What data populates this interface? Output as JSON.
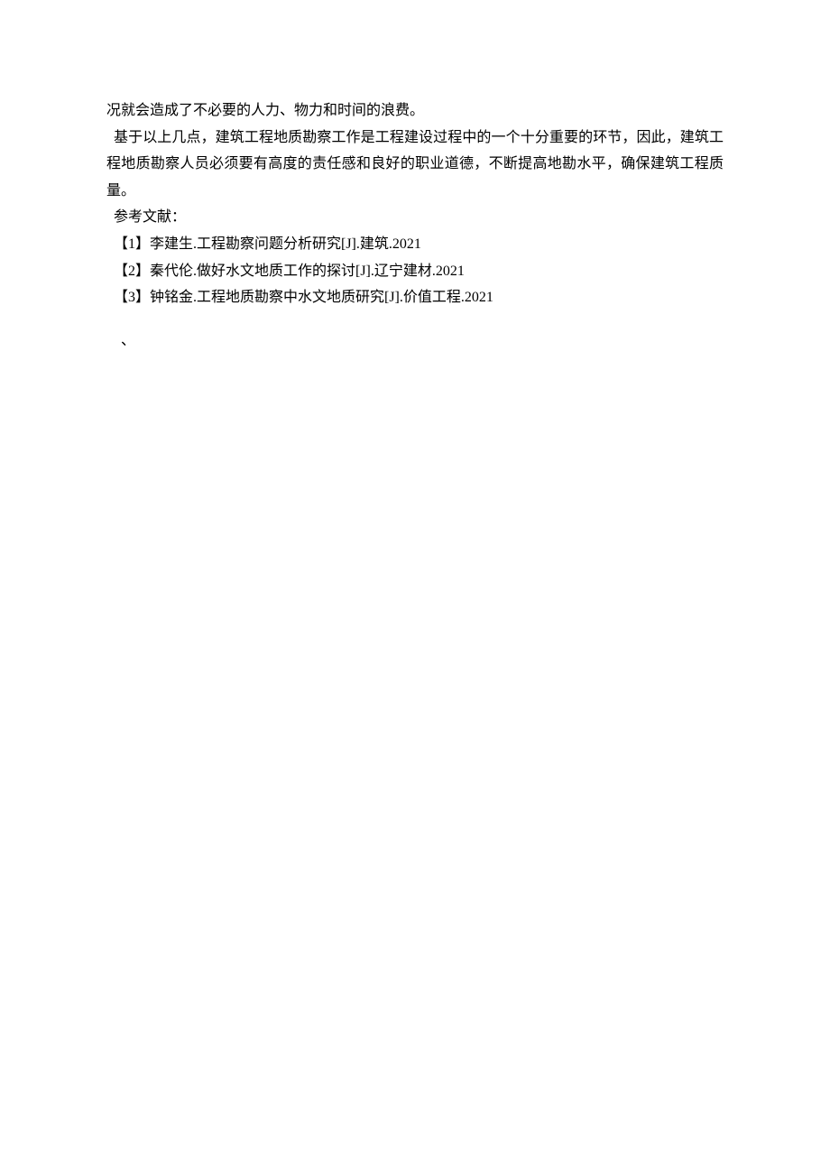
{
  "body": {
    "line1": "况就会造成了不必要的人力、物力和时间的浪费。",
    "line2": "基于以上几点，建筑工程地质勘察工作是工程建设过程中的一个十分重要的环节，因此，建筑工程地质勘察人员必须要有高度的责任感和良好的职业道德，不断提高地勘水平，确保建筑工程质量。",
    "refs_heading": "参考文献：",
    "refs": [
      "【1】李建生.工程勘察问题分析研究[J].建筑.2021",
      "【2】秦代伦.做好水文地质工作的探讨[J].辽宁建材.2021",
      "【3】钟铭金.工程地质勘察中水文地质研究[J].价值工程.2021"
    ],
    "tick": "、"
  }
}
